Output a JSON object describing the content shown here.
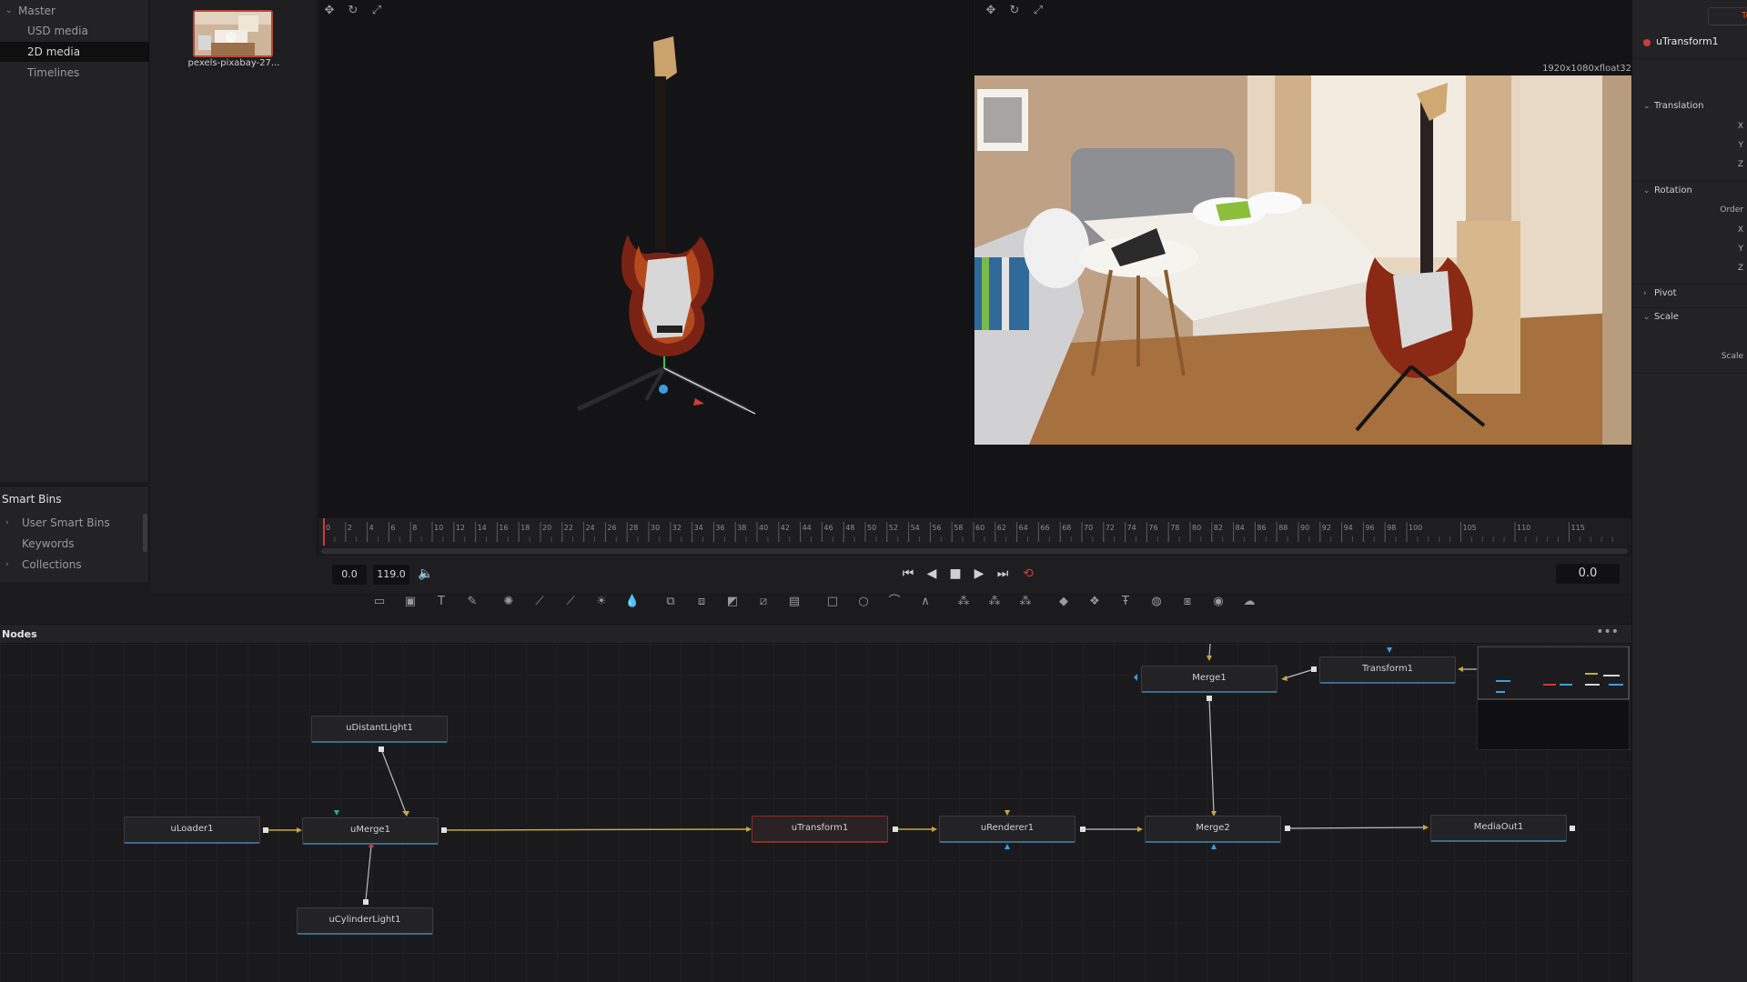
{
  "media_pool": {
    "tree": [
      {
        "label": "Master",
        "expanded": true
      },
      {
        "label": "USD media"
      },
      {
        "label": "2D media",
        "selected": true
      },
      {
        "label": "Timelines"
      }
    ],
    "clip": {
      "name": "pexels-pixabay-27..."
    }
  },
  "smart_bins": {
    "title": "Smart Bins",
    "items": [
      "User Smart Bins",
      "Keywords",
      "Collections"
    ]
  },
  "viewer": {
    "resolution_label": "1920x1080xfloat32"
  },
  "ruler": {
    "ticks": [
      "0",
      "2",
      "4",
      "6",
      "8",
      "10",
      "12",
      "14",
      "16",
      "18",
      "20",
      "22",
      "24",
      "26",
      "28",
      "30",
      "32",
      "34",
      "36",
      "38",
      "40",
      "42",
      "44",
      "46",
      "48",
      "50",
      "52",
      "54",
      "56",
      "58",
      "60",
      "62",
      "64",
      "66",
      "68",
      "70",
      "72",
      "74",
      "76",
      "78",
      "80",
      "82",
      "84",
      "86",
      "88",
      "90",
      "92",
      "94",
      "96",
      "98",
      "100",
      "105",
      "110",
      "115"
    ]
  },
  "transport": {
    "start": "0.0",
    "end": "119.0",
    "current": "0.0"
  },
  "nodes_panel": {
    "title": "Nodes",
    "more": "•••"
  },
  "nodes": {
    "uloader": "uLoader1",
    "umerge": "uMerge1",
    "udistant": "uDistantLight1",
    "ucylinder": "uCylinderLight1",
    "utransform": "uTransform1",
    "urenderer": "uRenderer1",
    "merge2": "Merge2",
    "merge1": "Merge1",
    "transform1": "Transform1",
    "mediaout": "MediaOut1"
  },
  "inspector": {
    "node_name": "uTransform1",
    "top_button": "To",
    "sections": {
      "translation": "Translation",
      "rotation": "Rotation",
      "pivot": "Pivot",
      "scale": "Scale"
    },
    "props": {
      "tx": "X",
      "ty": "Y",
      "tz": "Z",
      "order": "Order",
      "rx": "X",
      "ry": "Y",
      "rz": "Z",
      "scale": "Scale"
    }
  },
  "colors": {
    "selected_node_outline": "#8a2c2c",
    "wire_yellow": "#c9a642",
    "accent_red": "#d03a3a",
    "node_underline": "#3b6b8a"
  }
}
